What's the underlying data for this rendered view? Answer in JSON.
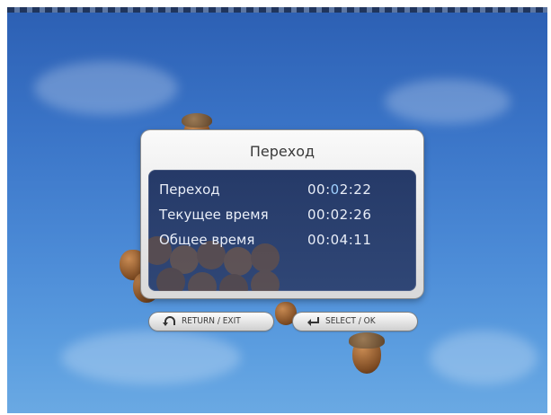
{
  "dialog": {
    "title": "Переход",
    "rows": [
      {
        "label": "Переход",
        "value_prefix": "00:",
        "value_highlight": "0",
        "value_suffix": "2:22"
      },
      {
        "label": "Текущее время",
        "value": "00:02:26"
      },
      {
        "label": "Общее время",
        "value": "00:04:11"
      }
    ]
  },
  "buttons": {
    "return_label": "RETURN / EXIT",
    "select_label": "SELECT / OK"
  },
  "icons": {
    "return": "return-arrow-icon",
    "select": "enter-arrow-icon"
  },
  "colors": {
    "sky": "#3a74c7",
    "panel": "#18326a",
    "highlight": "#9fd0ff"
  }
}
